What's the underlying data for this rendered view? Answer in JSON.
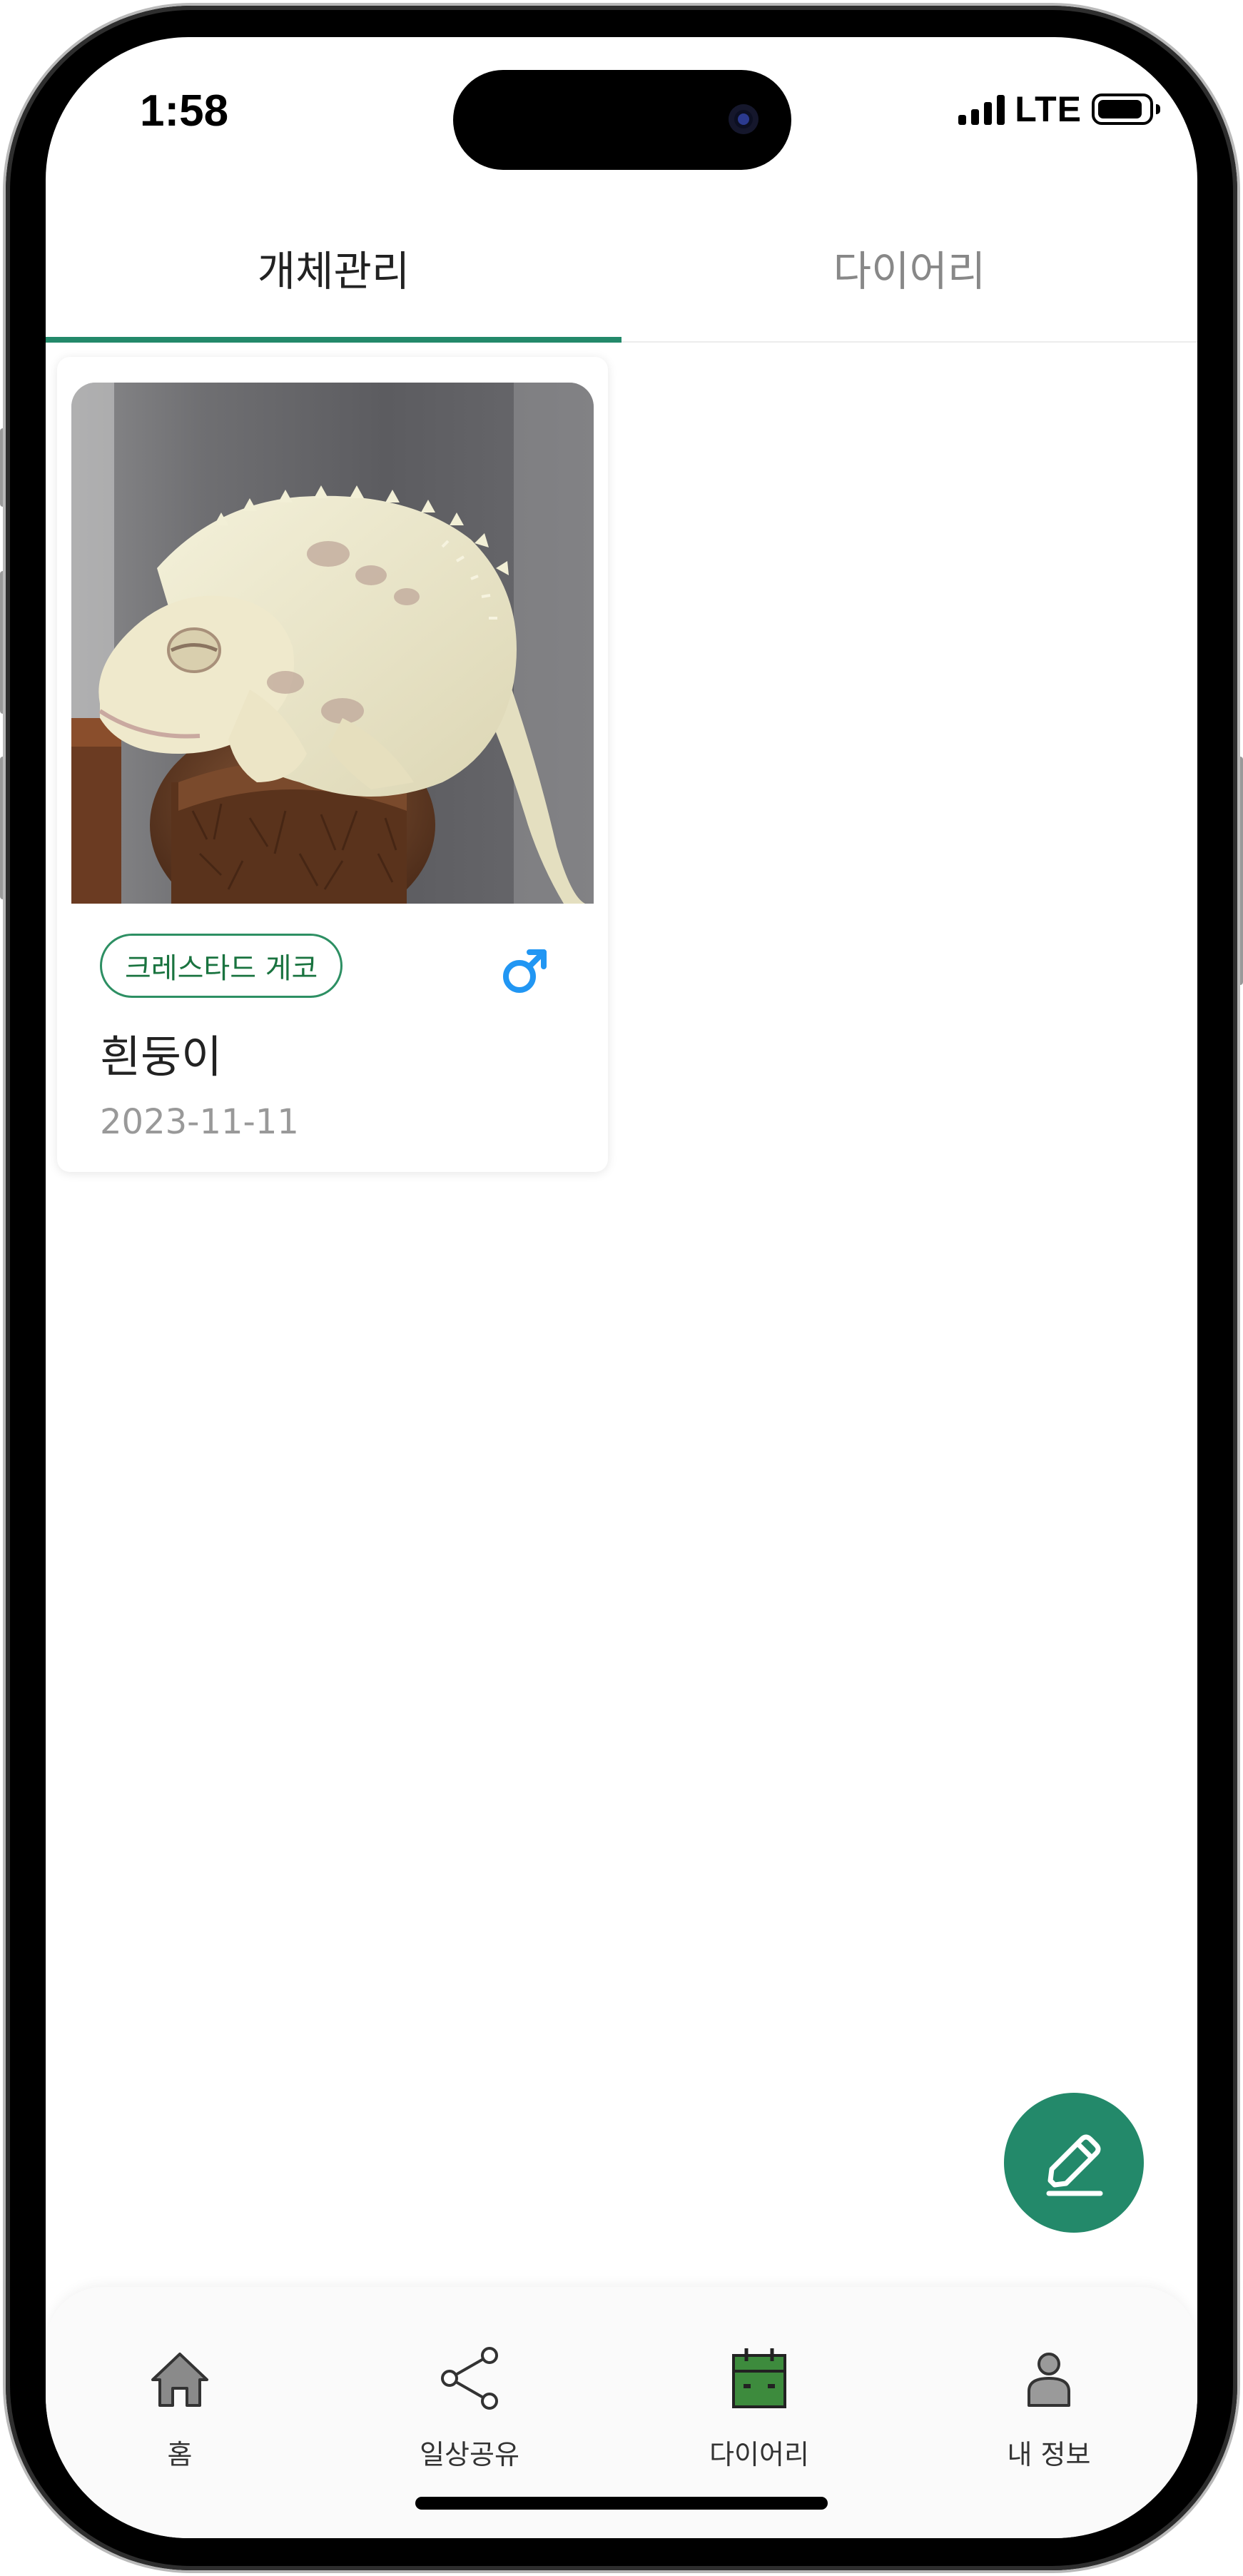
{
  "status_bar": {
    "time": "1:58",
    "network": "LTE",
    "icons": [
      "signal-icon",
      "battery-icon"
    ]
  },
  "tabs": [
    {
      "label": "개체관리",
      "active": true
    },
    {
      "label": "다이어리",
      "active": false
    }
  ],
  "animals": [
    {
      "species": "크레스타드 게코",
      "name": "흰둥이",
      "date": "2023-11-11",
      "gender_icon": "male-icon",
      "photo_icon": "gecko-photo"
    }
  ],
  "fab": {
    "icon": "pencil-icon"
  },
  "bottom_nav": [
    {
      "label": "홈",
      "icon": "home-icon",
      "active": false
    },
    {
      "label": "일상공유",
      "icon": "share-icon",
      "active": false
    },
    {
      "label": "다이어리",
      "icon": "calendar-icon",
      "active": true
    },
    {
      "label": "내 정보",
      "icon": "user-icon",
      "active": false
    }
  ],
  "colors": {
    "accent": "#23896a",
    "tag_border": "#2d8f63",
    "tag_text": "#19733f",
    "male": "#2196f3",
    "calendar_green": "#3d8b3d"
  }
}
